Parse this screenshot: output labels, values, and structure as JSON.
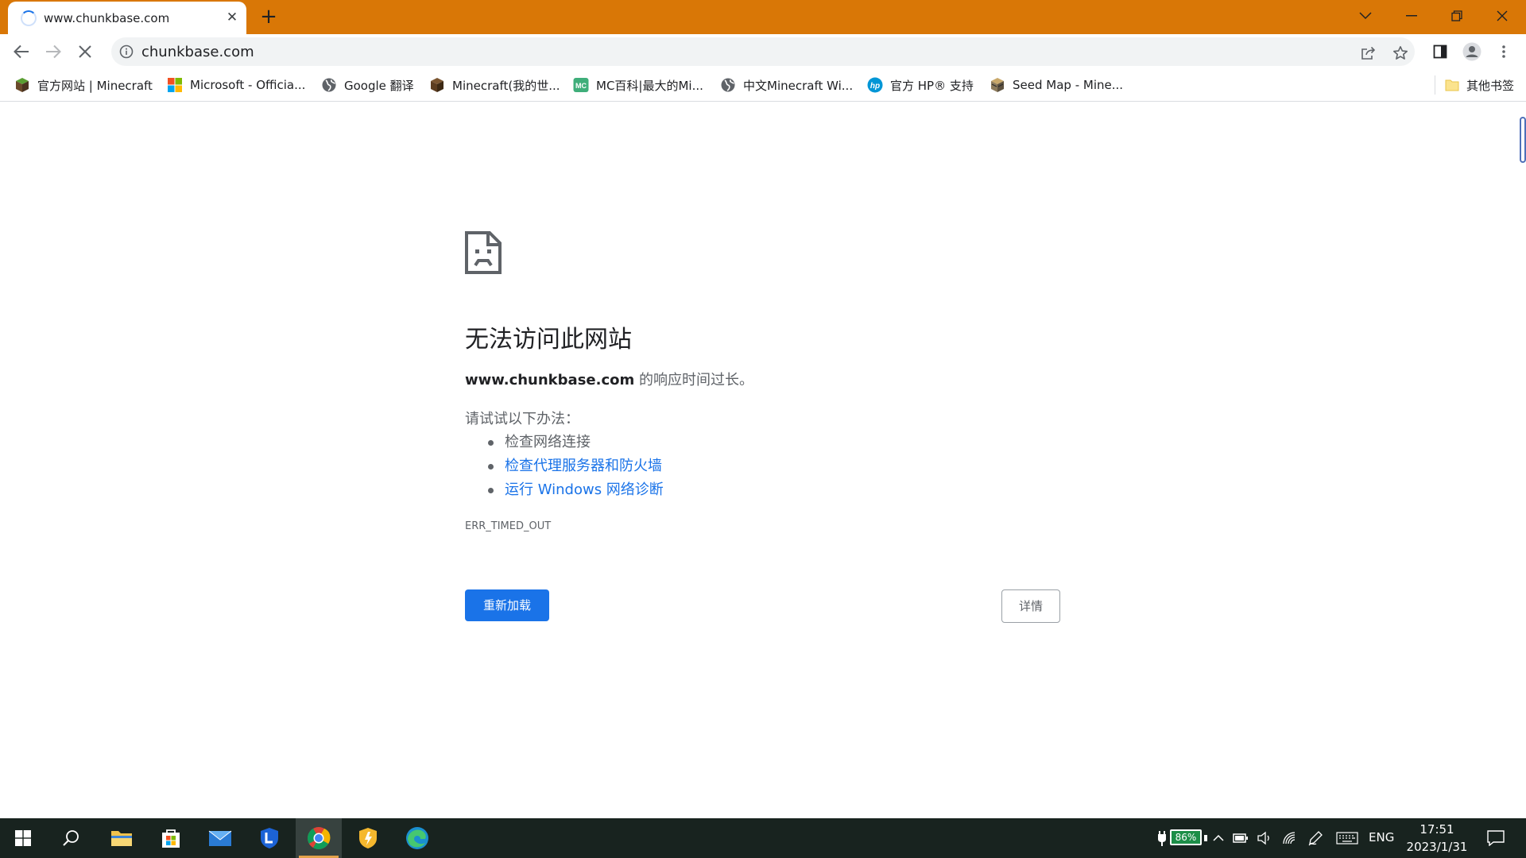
{
  "tab": {
    "title": "www.chunkbase.com",
    "close_glyph": "✕",
    "new_tab_glyph": "+"
  },
  "address_bar": {
    "url": "chunkbase.com"
  },
  "bookmarks": [
    {
      "label": "官方网站 | Minecraft",
      "icon": "minecraft-grass-block-icon"
    },
    {
      "label": "Microsoft - Officia...",
      "icon": "microsoft-logo-icon"
    },
    {
      "label": "Google 翻译",
      "icon": "globe-icon"
    },
    {
      "label": "Minecraft(我的世...",
      "icon": "minecraft-block-icon"
    },
    {
      "label": "MC百科|最大的Mi...",
      "icon": "mcmod-icon"
    },
    {
      "label": "中文Minecraft Wi...",
      "icon": "globe-icon"
    },
    {
      "label": "官方 HP® 支持",
      "icon": "hp-logo-icon"
    },
    {
      "label": "Seed Map - Mine...",
      "icon": "chunkbase-icon"
    }
  ],
  "other_bookmarks": "其他书签",
  "error_page": {
    "title": "无法访问此网站",
    "host": "www.chunkbase.com",
    "message_suffix": " 的响应时间过长。",
    "try_heading": "请试试以下办法：",
    "suggestions": [
      {
        "text": "检查网络连接",
        "is_link": false
      },
      {
        "text": "检查代理服务器和防火墙",
        "is_link": true
      },
      {
        "text": "运行 Windows 网络诊断",
        "is_link": true
      }
    ],
    "error_code": "ERR_TIMED_OUT",
    "reload_label": "重新加载",
    "details_label": "详情"
  },
  "taskbar": {
    "battery_percent": "86%",
    "language": "ENG",
    "time": "17:51",
    "date": "2023/1/31"
  },
  "colors": {
    "tab_strip": "#d97706",
    "accent_blue": "#1a73e8",
    "taskbar": "#18231f",
    "battery_green": "#1d8e48"
  }
}
